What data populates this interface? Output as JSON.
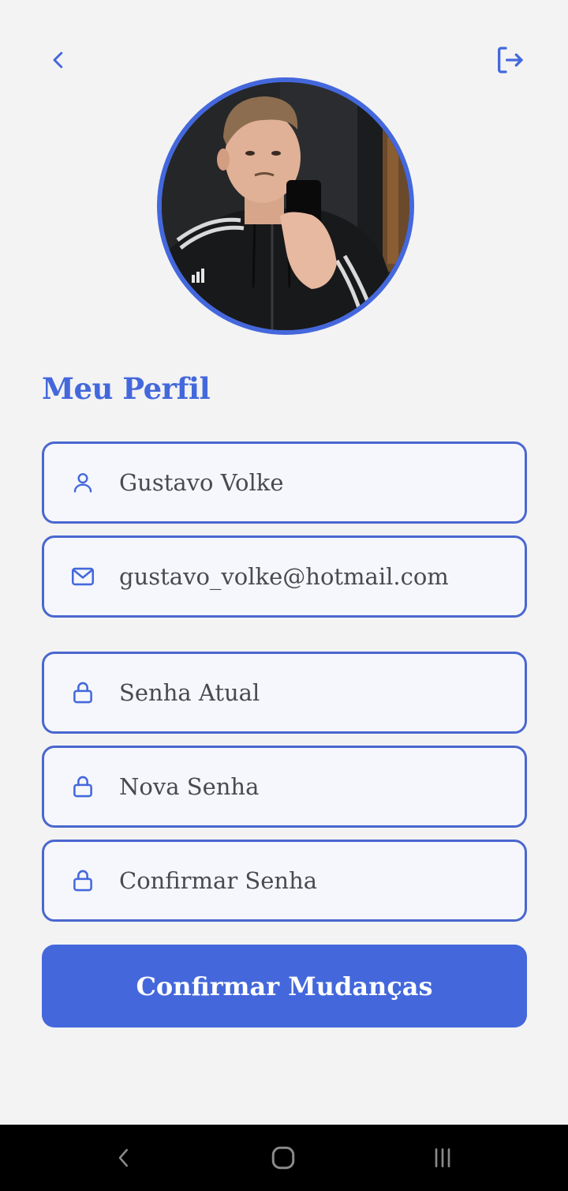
{
  "colors": {
    "accent": "#4468dc",
    "field_border": "#4a67cf",
    "field_bg": "#f5f7fc",
    "page_bg": "#f3f3f4",
    "text": "#4a4a4e",
    "nav_bar": "#000000"
  },
  "header": {
    "back_icon": "chevron-left-icon",
    "logout_icon": "logout-icon"
  },
  "profile": {
    "title": "Meu Perfil",
    "avatar_alt": "profile photo"
  },
  "form": {
    "name": {
      "icon": "user-icon",
      "value": "Gustavo Volke"
    },
    "email": {
      "icon": "mail-icon",
      "value": "gustavo_volke@hotmail.com"
    },
    "current_password": {
      "icon": "lock-icon",
      "placeholder": "Senha Atual"
    },
    "new_password": {
      "icon": "lock-icon",
      "placeholder": "Nova Senha"
    },
    "confirm_password": {
      "icon": "lock-icon",
      "placeholder": "Confirmar Senha"
    },
    "submit_label": "Confirmar Mudanças"
  },
  "system_nav": {
    "back_icon": "nav-back-icon",
    "home_icon": "nav-home-icon",
    "recents_icon": "nav-recents-icon"
  }
}
